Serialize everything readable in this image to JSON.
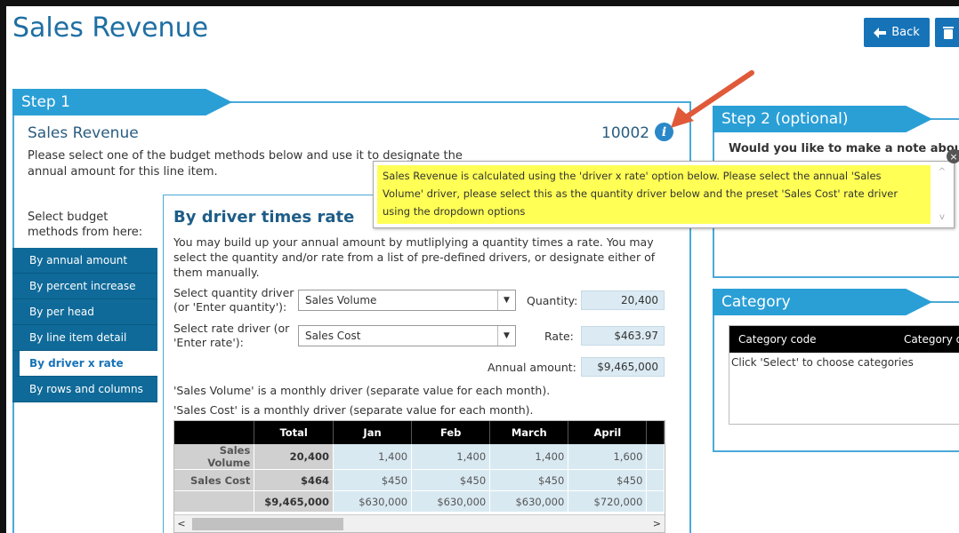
{
  "header": {
    "title": "Sales Revenue",
    "back_label": "Back"
  },
  "step1": {
    "tab_label": "Step 1",
    "item_name": "Sales Revenue",
    "item_code": "10002",
    "instructions": "Please select one of the budget methods below and use it to designate the annual amount for this line item.",
    "nav_label": "Select budget methods from here:",
    "nav_items": [
      {
        "label": "By annual amount",
        "active": false
      },
      {
        "label": "By percent increase",
        "active": false
      },
      {
        "label": "By per head",
        "active": false
      },
      {
        "label": "By line item detail",
        "active": false
      },
      {
        "label": "By driver x rate",
        "active": true
      },
      {
        "label": "By rows and columns",
        "active": false
      }
    ]
  },
  "method": {
    "title": "By driver times rate",
    "description": "You may build up your annual amount by mutliplying a quantity times a rate. You may select the quantity and/or rate from a list of pre-defined drivers, or designate either of them manually.",
    "quantity_driver_label": "Select quantity driver (or 'Enter quantity'):",
    "quantity_driver_value": "Sales Volume",
    "quantity_label": "Quantity:",
    "quantity_value": "20,400",
    "rate_driver_label": "Select rate driver (or 'Enter rate'):",
    "rate_driver_value": "Sales Cost",
    "rate_label": "Rate:",
    "rate_value": "$463.97",
    "annual_label": "Annual amount:",
    "annual_value": "$9,465,000",
    "note1": "'Sales Volume' is a monthly driver (separate value for each month).",
    "note2": "'Sales Cost' is a monthly driver (separate value for each month)."
  },
  "grid": {
    "columns": [
      "",
      "Total",
      "Jan",
      "Feb",
      "March",
      "April"
    ],
    "rows": [
      {
        "label": "Sales Volume",
        "total": "20,400",
        "values": [
          "1,400",
          "1,400",
          "1,400",
          "1,600"
        ]
      },
      {
        "label": "Sales Cost",
        "total": "$464",
        "values": [
          "$450",
          "$450",
          "$450",
          "$450"
        ]
      },
      {
        "label": "",
        "total": "$9,465,000",
        "values": [
          "$630,000",
          "$630,000",
          "$630,000",
          "$720,000"
        ]
      }
    ]
  },
  "step2": {
    "tab_label": "Step 2 (optional)",
    "question": "Would you like to make a note about"
  },
  "category": {
    "tab_label": "Category",
    "col1": "Category code",
    "col2": "Category d",
    "hint": "Click 'Select' to choose categories"
  },
  "tooltip": {
    "text": "Sales Revenue is calculated using the 'driver x rate' option below. Please select the annual 'Sales Volume' driver, please select this as the quantity driver below and the preset 'Sales Cost' rate driver using the dropdown options"
  },
  "colors": {
    "accent": "#2a9fd6",
    "nav_bg": "#0f6a99",
    "tooltip_bg": "#ffff55",
    "arrow": "#e05a3a"
  }
}
